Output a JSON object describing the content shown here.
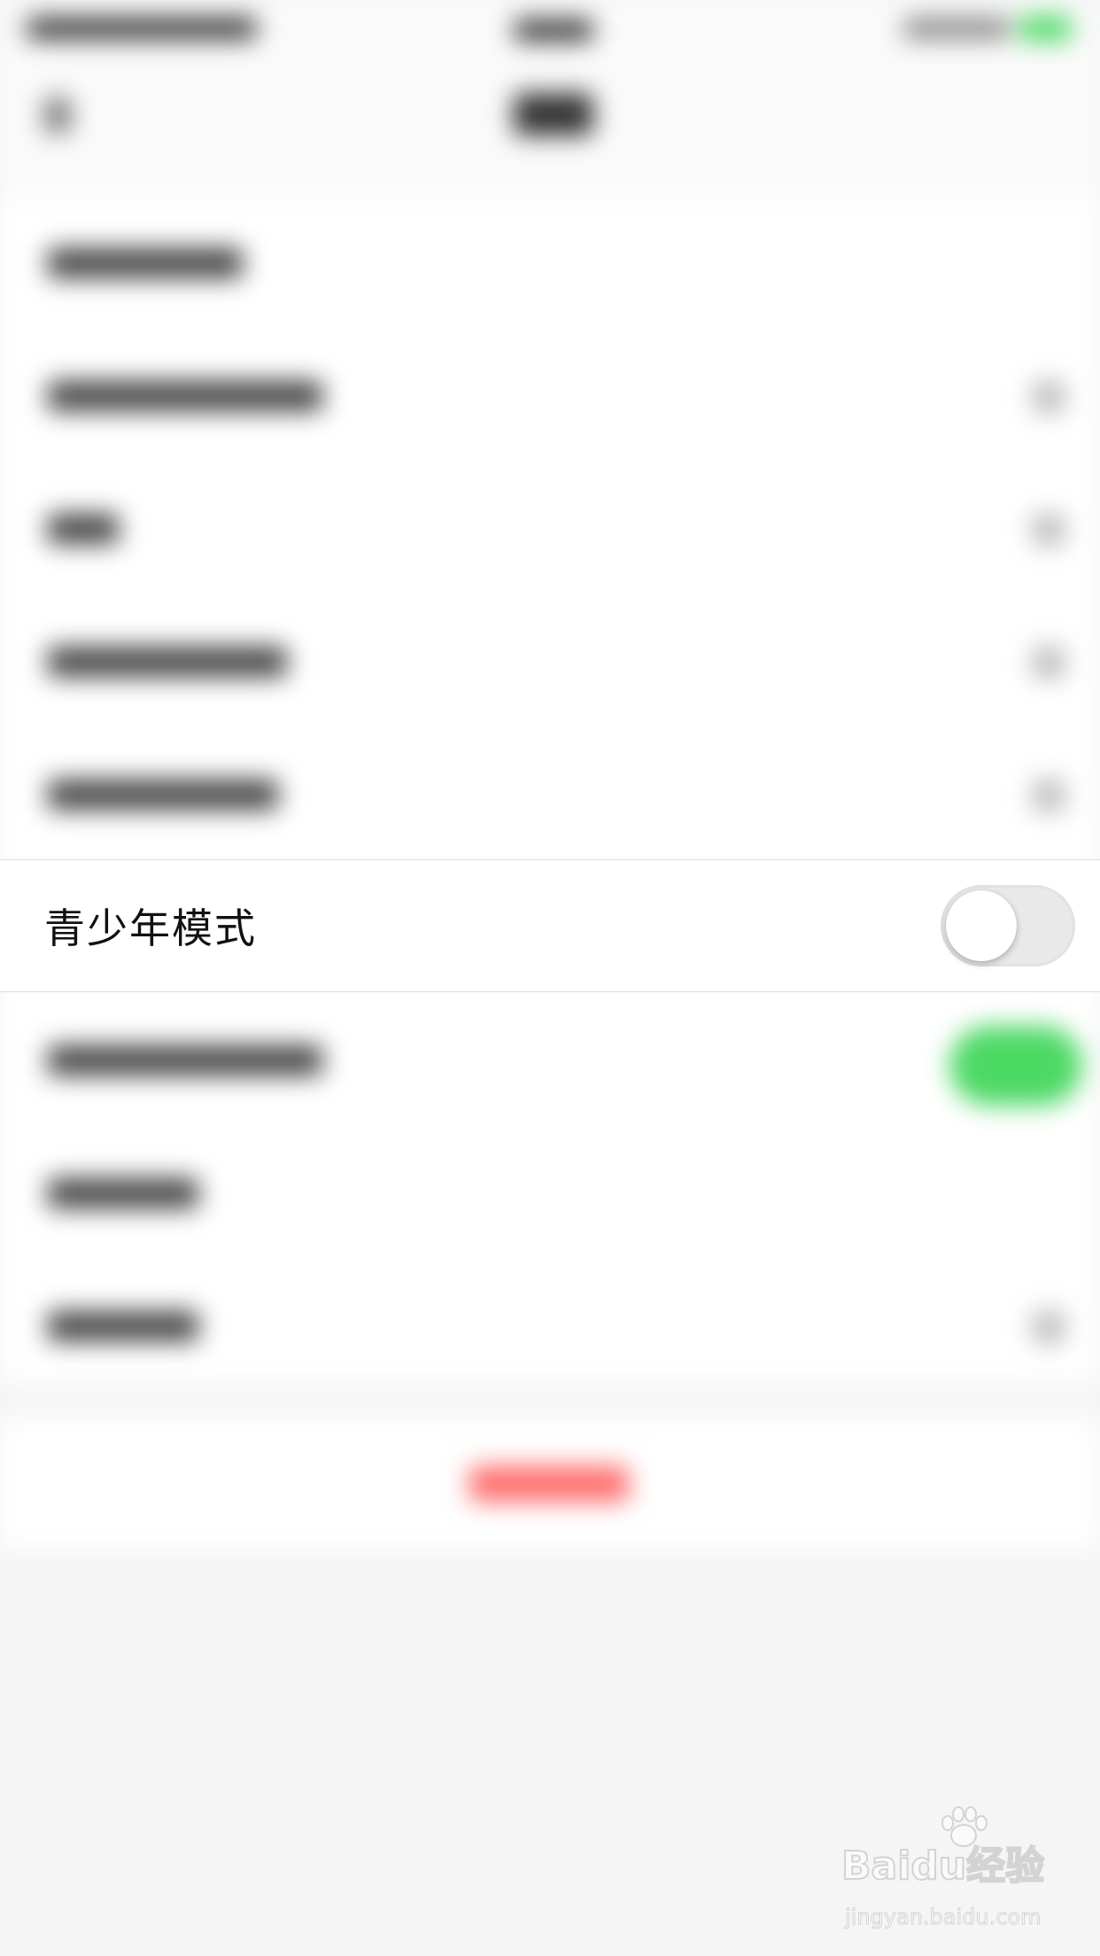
{
  "settings_row": {
    "label": "青少年模式",
    "toggle_on": false
  },
  "colors": {
    "toggle_off_track": "#e9e9ea",
    "toggle_on_track": "#4cd964",
    "logout_red": "#ff6b6b",
    "background": "#f5f5f5"
  },
  "watermark": {
    "logo_text": "Baidu经验",
    "url": "jingyan.baidu.com"
  }
}
